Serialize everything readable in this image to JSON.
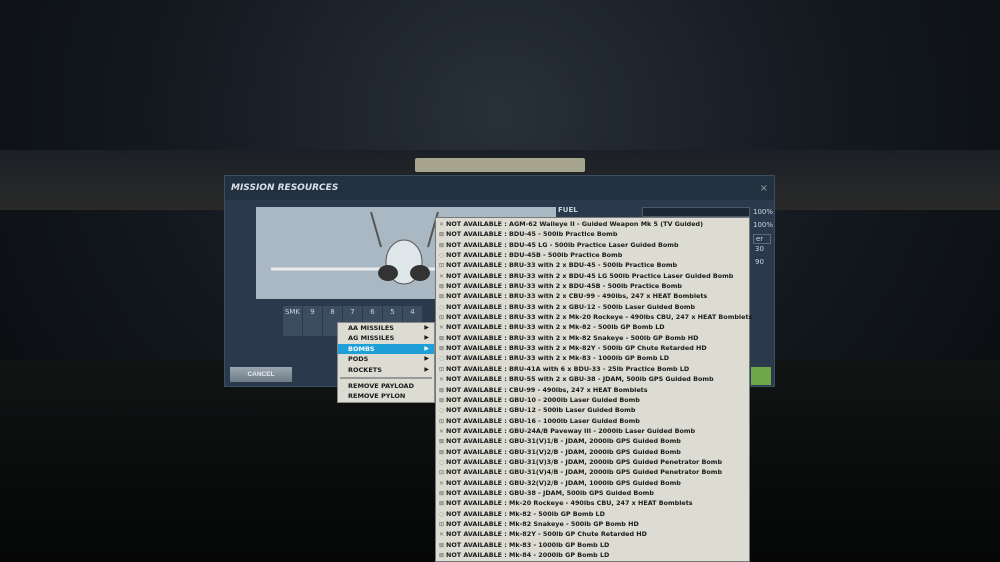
{
  "dialog": {
    "title": "MISSION RESOURCES",
    "close": "×",
    "fuel_label": "FUEL",
    "fuel_pct": "100%",
    "pct2": "100%",
    "val1": "30",
    "val2": "90",
    "field": "er",
    "cancel": "CANCEL"
  },
  "pylons": [
    "SMK",
    "9",
    "8",
    "7",
    "6",
    "5",
    "4"
  ],
  "context_menu": [
    {
      "label": "AA MISSILES",
      "sub": true
    },
    {
      "label": "AG MISSILES",
      "sub": true
    },
    {
      "label": "BOMBS",
      "sub": true,
      "selected": true
    },
    {
      "label": "PODS",
      "sub": true
    },
    {
      "label": "ROCKETS",
      "sub": true
    },
    {
      "label": "REMOVE PAYLOAD"
    },
    {
      "label": "REMOVE PYLON"
    }
  ],
  "arrow": "▶",
  "bombs": [
    "NOT AVAILABLE : AGM-62 Walleye II - Guided Weapon Mk 5 (TV Guided)",
    "NOT AVAILABLE : BDU-45 - 500lb Practice Bomb",
    "NOT AVAILABLE : BDU-45 LG - 500lb Practice Laser Guided Bomb",
    "NOT AVAILABLE : BDU-45B - 500lb Practice Bomb",
    "NOT AVAILABLE : BRU-33 with 2 x BDU-45 - 500lb Practice Bomb",
    "NOT AVAILABLE : BRU-33 with 2 x BDU-45 LG 500lb Practice Laser Guided Bomb",
    "NOT AVAILABLE : BRU-33 with 2 x BDU-45B - 500lb Practice Bomb",
    "NOT AVAILABLE : BRU-33 with 2 x CBU-99 - 490lbs, 247 x HEAT Bomblets",
    "NOT AVAILABLE : BRU-33 with 2 x GBU-12 - 500lb Laser Guided Bomb",
    "NOT AVAILABLE : BRU-33 with 2 x Mk-20 Rockeye - 490lbs CBU, 247 x HEAT Bomblets",
    "NOT AVAILABLE : BRU-33 with 2 x Mk-82 - 500lb GP Bomb LD",
    "NOT AVAILABLE : BRU-33 with 2 x Mk-82 Snakeye - 500lb GP Bomb HD",
    "NOT AVAILABLE : BRU-33 with 2 x Mk-82Y - 500lb GP Chute Retarded HD",
    "NOT AVAILABLE : BRU-33 with 2 x Mk-83 - 1000lb GP Bomb LD",
    "NOT AVAILABLE : BRU-41A with 6 x BDU-33 - 25lb Practice Bomb LD",
    "NOT AVAILABLE : BRU-55 with 2 x GBU-38 - JDAM, 500lb GPS Guided Bomb",
    "NOT AVAILABLE : CBU-99 - 490lbs, 247 x HEAT Bomblets",
    "NOT AVAILABLE : GBU-10 - 2000lb Laser Guided Bomb",
    "NOT AVAILABLE : GBU-12 - 500lb Laser Guided Bomb",
    "NOT AVAILABLE : GBU-16 - 1000lb Laser Guided Bomb",
    "NOT AVAILABLE : GBU-24A/B Paveway III - 2000lb Laser Guided Bomb",
    "NOT AVAILABLE : GBU-31(V)1/B - JDAM, 2000lb GPS Guided Bomb",
    "NOT AVAILABLE : GBU-31(V)2/B - JDAM, 2000lb GPS Guided Bomb",
    "NOT AVAILABLE : GBU-31(V)3/B - JDAM, 2000lb GPS Guided Penetrator Bomb",
    "NOT AVAILABLE : GBU-31(V)4/B - JDAM, 2000lb GPS Guided Penetrator Bomb",
    "NOT AVAILABLE : GBU-32(V)2/B - JDAM, 1000lb GPS Guided Bomb",
    "NOT AVAILABLE : GBU-38 - JDAM, 500lb GPS Guided Bomb",
    "NOT AVAILABLE : Mk-20 Rockeye - 490lbs CBU, 247 x HEAT Bomblets",
    "NOT AVAILABLE : Mk-82 - 500lb GP Bomb LD",
    "NOT AVAILABLE : Mk-82 Snakeye - 500lb GP Bomb HD",
    "NOT AVAILABLE : Mk-82Y - 500lb GP Chute Retarded HD",
    "NOT AVAILABLE : Mk-83 - 1000lb GP Bomb LD",
    "NOT AVAILABLE : Mk-84 - 2000lb GP Bomb LD"
  ]
}
